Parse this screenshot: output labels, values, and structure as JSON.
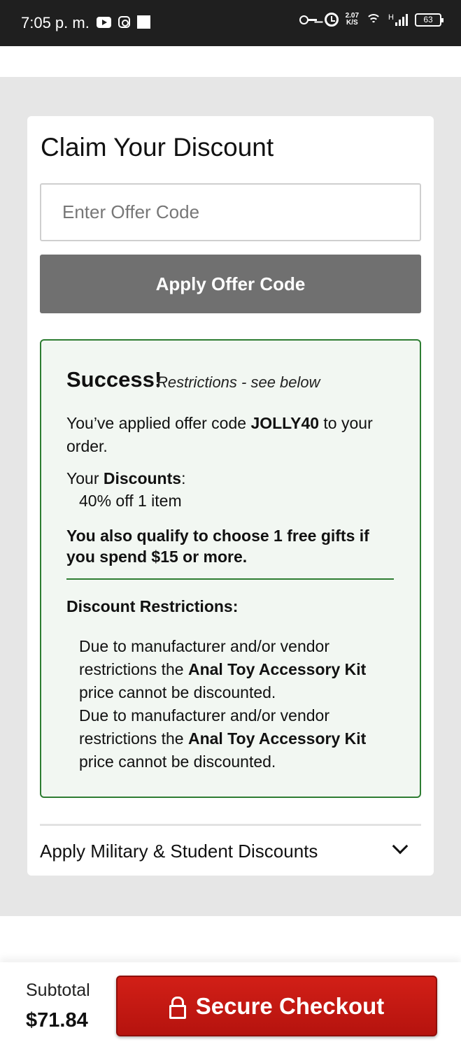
{
  "status_bar": {
    "time": "7:05 p. m.",
    "speed_value": "2.07",
    "speed_unit": "K/S",
    "network": "H",
    "battery": "63"
  },
  "discount_card": {
    "title": "Claim Your Discount",
    "input_placeholder": "Enter Offer Code",
    "apply_label": "Apply Offer Code"
  },
  "success": {
    "heading": "Success!",
    "note": "Restrictions - see below",
    "applied_prefix": "You’ve applied offer code ",
    "offer_code": "JOLLY40",
    "applied_suffix": " to your order.",
    "discounts_prefix": "Your ",
    "discounts_label": "Discounts",
    "discounts_suffix": ":",
    "discount_item": "40% off 1 item",
    "gift_text": "You also qualify to choose 1 free gifts if you spend $15 or more.",
    "restrictions_heading": "Discount Restrictions:",
    "restrictions": [
      {
        "prefix": "Due to manufacturer and/or vendor restrictions the ",
        "product": "Anal Toy Accessory Kit",
        "suffix": " price cannot be discounted."
      },
      {
        "prefix": "Due to manufacturer and/or vendor restrictions the ",
        "product": "Anal Toy Accessory Kit",
        "suffix": " price cannot be discounted."
      }
    ]
  },
  "military": {
    "label": "Apply Military & Student Discounts"
  },
  "footer": {
    "subtotal_label": "Subtotal",
    "subtotal_value": "$71.84",
    "checkout_label": "Secure Checkout"
  },
  "colors": {
    "checkout_red": "#c8190f",
    "success_green": "#2e7d32",
    "apply_grey": "#707070"
  }
}
